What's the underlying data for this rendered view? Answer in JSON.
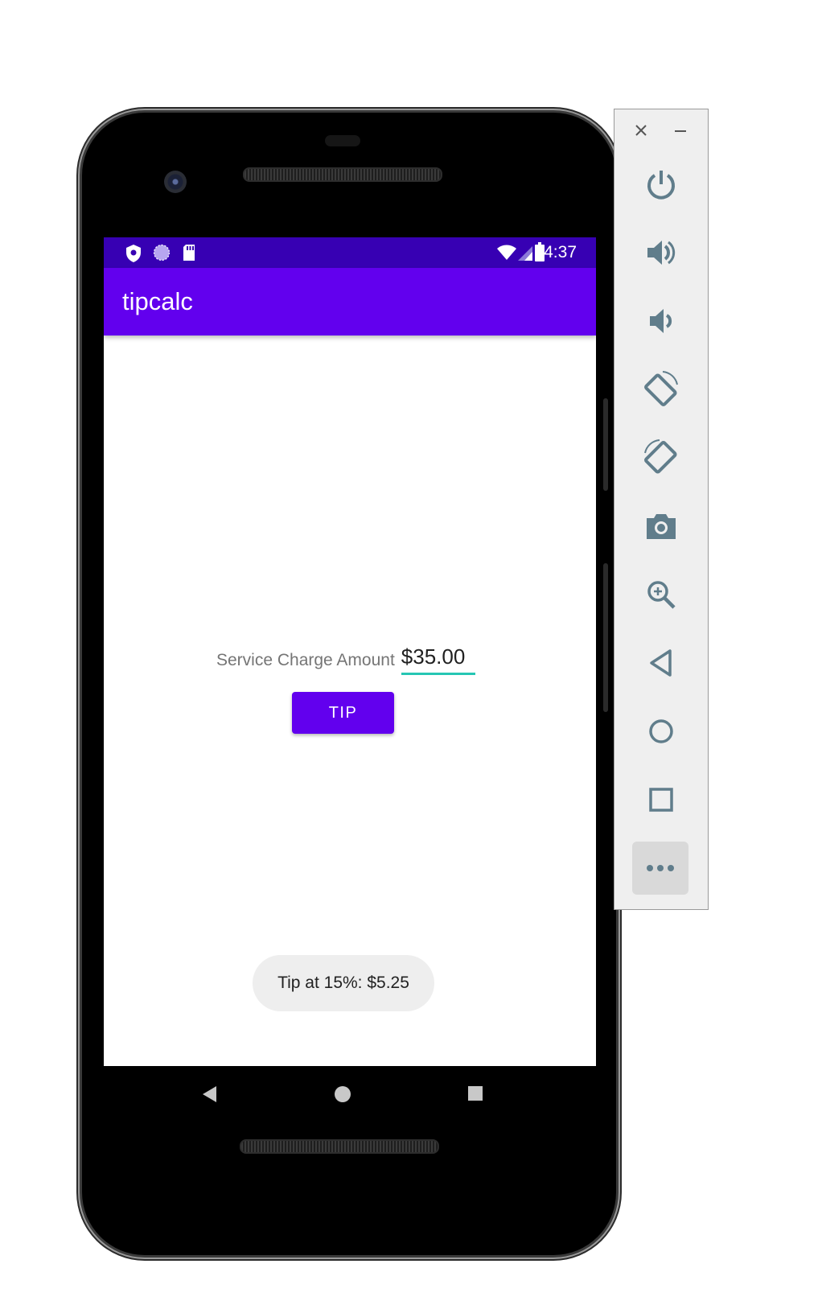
{
  "emulator_panel": {
    "close_icon": "close-icon",
    "minimize_icon": "minimize-icon",
    "buttons": [
      {
        "name": "power-icon"
      },
      {
        "name": "volume-up-icon"
      },
      {
        "name": "volume-down-icon"
      },
      {
        "name": "rotate-left-icon"
      },
      {
        "name": "rotate-right-icon"
      },
      {
        "name": "camera-icon"
      },
      {
        "name": "zoom-icon"
      },
      {
        "name": "back-icon"
      },
      {
        "name": "home-icon"
      },
      {
        "name": "overview-icon"
      },
      {
        "name": "more-icon"
      }
    ],
    "icon_color": "#607d8b"
  },
  "statusbar": {
    "time": "4:37",
    "color": "#3700b3"
  },
  "appbar": {
    "title": "tipcalc",
    "color": "#6200ee"
  },
  "form": {
    "label": "Service Charge Amount",
    "amount_value": "$35.00",
    "underline_color": "#26c6b4"
  },
  "tip_button": {
    "label": "TIP"
  },
  "toast": {
    "message": "Tip at 15%: $5.25"
  }
}
